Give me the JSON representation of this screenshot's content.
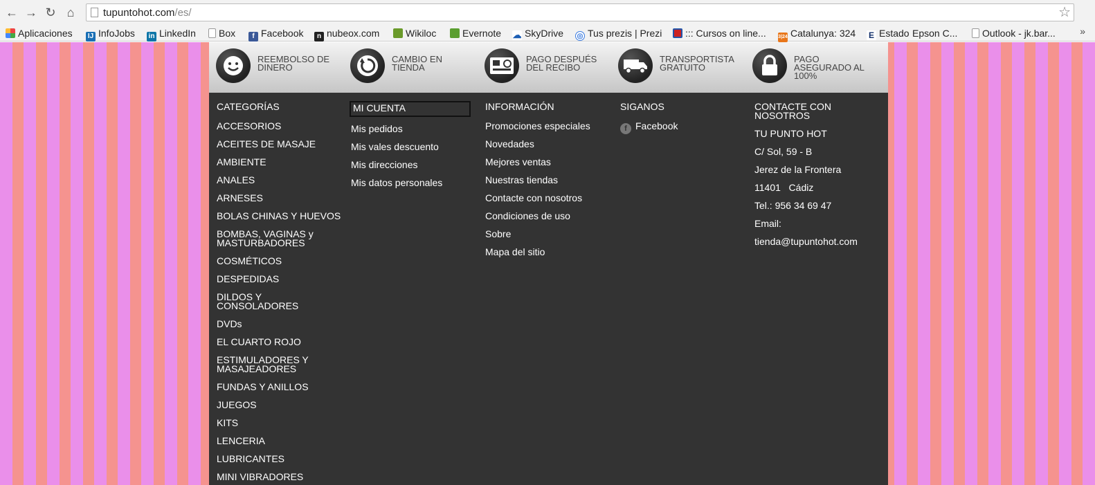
{
  "browser": {
    "url_domain": "tupuntohot.com",
    "url_path": "/es/",
    "bookmarks": [
      {
        "label": "Aplicaciones",
        "icon": "apps-grid-icon"
      },
      {
        "label": "InfoJobs",
        "icon": "infojobs-icon"
      },
      {
        "label": "LinkedIn",
        "icon": "linkedin-icon"
      },
      {
        "label": "Box",
        "icon": "page-icon"
      },
      {
        "label": "Facebook",
        "icon": "facebook-icon"
      },
      {
        "label": "nubeox.com",
        "icon": "nubeox-icon"
      },
      {
        "label": "Wikiloc",
        "icon": "wikiloc-icon"
      },
      {
        "label": "Evernote",
        "icon": "evernote-icon"
      },
      {
        "label": "SkyDrive",
        "icon": "skydrive-icon"
      },
      {
        "label": "Tus prezis | Prezi",
        "icon": "prezi-icon"
      },
      {
        "label": "::: Cursos on line...",
        "icon": "cursos-icon"
      },
      {
        "label": "Catalunya: 324",
        "icon": "catalunya-324-icon"
      },
      {
        "label": "Estado",
        "icon": "estado-icon"
      },
      {
        "label": "Epson C...",
        "icon": "none"
      },
      {
        "label": "Outlook - jk.bar...",
        "icon": "page-icon"
      }
    ]
  },
  "reassurance": [
    {
      "label": "REEMBOLSO DE DINERO",
      "icon": "smile-icon"
    },
    {
      "label": "CAMBIO EN TIENDA",
      "icon": "refresh-icon"
    },
    {
      "label": "PAGO DESPUÉS DEL RECIBO",
      "icon": "credit-card-icon"
    },
    {
      "label": "TRANSPORTISTA GRATUITO",
      "icon": "truck-icon"
    },
    {
      "label": "PAGO ASEGURADO AL 100%",
      "icon": "lock-icon"
    }
  ],
  "footer": {
    "categories": {
      "title": "CATEGORÍAS",
      "items": [
        "ACCESORIOS",
        "ACEITES DE MASAJE",
        "AMBIENTE",
        "ANALES",
        "ARNESES",
        "BOLAS CHINAS Y HUEVOS",
        "BOMBAS, VAGINAS y MASTURBADORES",
        "COSMÉTICOS",
        "DESPEDIDAS",
        "DILDOS Y CONSOLADORES",
        "DVDs",
        "EL CUARTO ROJO",
        "ESTIMULADORES Y MASAJEADORES",
        "FUNDAS Y ANILLOS",
        "JUEGOS",
        "KITS",
        "LENCERIA",
        "LUBRICANTES",
        "MINI VIBRADORES"
      ]
    },
    "account": {
      "title": "MI CUENTA",
      "items": [
        "Mis pedidos",
        "Mis vales descuento",
        "Mis direcciones",
        "Mis datos personales"
      ]
    },
    "information": {
      "title": "INFORMACIÓN",
      "items": [
        "Promociones especiales",
        "Novedades",
        "Mejores ventas",
        "Nuestras tiendas",
        "Contacte con nosotros",
        "Condiciones de uso",
        "Sobre",
        "Mapa del sitio"
      ]
    },
    "follow": {
      "title": "SIGANOS",
      "facebook": "Facebook"
    },
    "contact": {
      "title": "CONTACTE CON NOSOTROS",
      "name": "TU PUNTO HOT",
      "address1": "C/ Sol, 59 - B",
      "address2": "Jerez de la Frontera",
      "address3": "11401   Cádiz",
      "phone": "Tel.: 956 34 69 47",
      "email_label": "Email:",
      "email": "tienda@tupuntohot.com"
    }
  },
  "colors": {
    "footer_bg": "#333333",
    "stripe_pink": "#ea8fea",
    "stripe_salmon": "#f5938f"
  }
}
